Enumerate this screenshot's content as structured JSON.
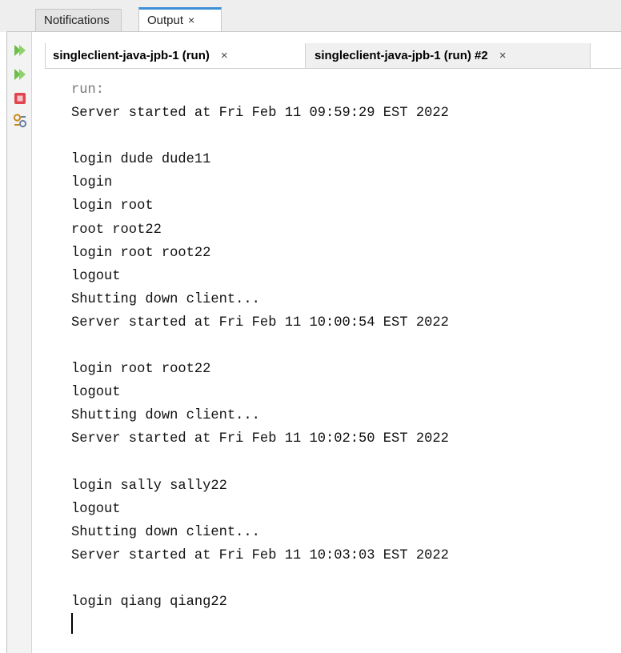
{
  "outer_tabs": {
    "notifications_label": "Notifications",
    "output_label": "Output",
    "close_glyph": "×"
  },
  "toolbar": {
    "buttons": [
      {
        "name": "rerun-icon"
      },
      {
        "name": "rerun-with-options-icon"
      },
      {
        "name": "stop-icon",
        "color": "#e0454f"
      },
      {
        "name": "settings-icon"
      }
    ]
  },
  "inner_tabs": {
    "tab1_label": "singleclient-java-jpb-1 (run)",
    "tab2_label": "singleclient-java-jpb-1 (run) #2",
    "close_glyph": "×"
  },
  "console": {
    "lines": [
      "run:",
      "Server started at Fri Feb 11 09:59:29 EST 2022",
      "",
      "login dude dude11",
      "login",
      "login root",
      "root root22",
      "login root root22",
      "logout",
      "Shutting down client...",
      "Server started at Fri Feb 11 10:00:54 EST 2022",
      "",
      "login root root22",
      "logout",
      "Shutting down client...",
      "Server started at Fri Feb 11 10:02:50 EST 2022",
      "",
      "login sally sally22",
      "logout",
      "Shutting down client...",
      "Server started at Fri Feb 11 10:03:03 EST 2022",
      "",
      "login qiang qiang22"
    ]
  },
  "colors": {
    "accent": "#3c8fd8",
    "run_green": "#6cbf4a",
    "stop_red": "#e0454f"
  }
}
